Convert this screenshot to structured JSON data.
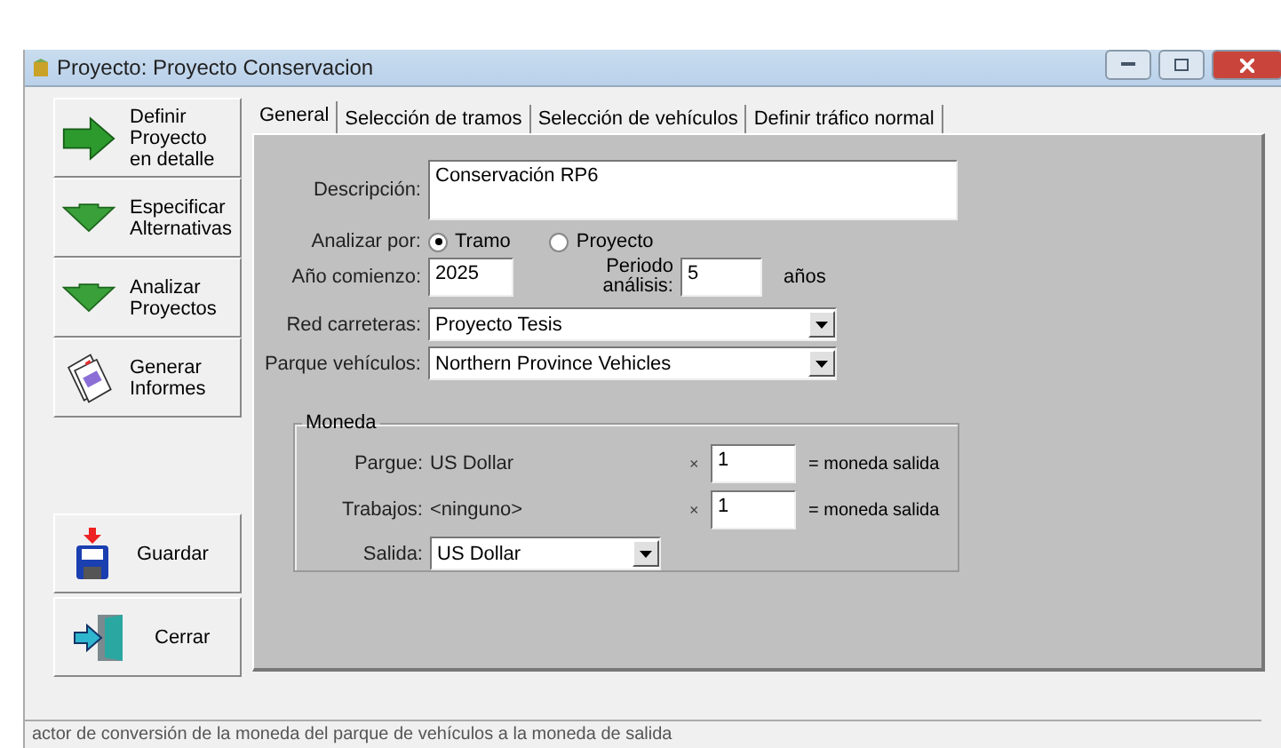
{
  "window": {
    "title": "Proyecto: Proyecto Conservacion"
  },
  "sidebar": {
    "steps": [
      {
        "label": "Definir Proyecto en detalle",
        "kind": "arrow-right"
      },
      {
        "label": "Especificar Alternativas",
        "kind": "arrow-down"
      },
      {
        "label": "Analizar Proyectos",
        "kind": "arrow-down"
      },
      {
        "label": "Generar Informes",
        "kind": "report"
      }
    ],
    "actions": [
      {
        "label": "Guardar",
        "kind": "save"
      },
      {
        "label": "Cerrar",
        "kind": "exit"
      }
    ]
  },
  "tabs": [
    {
      "label": "General",
      "selected": true
    },
    {
      "label": "Selección de tramos",
      "selected": false
    },
    {
      "label": "Selección de vehículos",
      "selected": false
    },
    {
      "label": "Definir tráfico normal",
      "selected": false
    }
  ],
  "form": {
    "descripcion": {
      "label": "Descripción:",
      "value": "Conservación RP6"
    },
    "analizar_por": {
      "label": "Analizar por:",
      "options": [
        {
          "label": "Tramo",
          "selected": true
        },
        {
          "label": "Proyecto",
          "selected": false
        }
      ]
    },
    "anio_comienzo": {
      "label": "Año comienzo:",
      "value": "2025"
    },
    "periodo": {
      "label": "Periodo análisis:",
      "value": "5",
      "unit": "años"
    },
    "red_carreteras": {
      "label": "Red carreteras:",
      "value": "Proyecto Tesis"
    },
    "parque_vehiculos": {
      "label": "Parque vehículos:",
      "value": "Northern Province Vehicles"
    }
  },
  "moneda": {
    "title": "Moneda",
    "rows": [
      {
        "label": "Pargue:",
        "currency": "US Dollar",
        "times": "×",
        "factor": "1",
        "result": "= moneda salida"
      },
      {
        "label": "Trabajos:",
        "currency": "<ninguno>",
        "times": "×",
        "factor": "1",
        "result": "= moneda salida"
      }
    ],
    "salida": {
      "label": "Salida:",
      "value": "US Dollar"
    }
  },
  "status_bar": {
    "text": "actor de conversión de la moneda del parque de vehículos a la moneda de salida"
  }
}
